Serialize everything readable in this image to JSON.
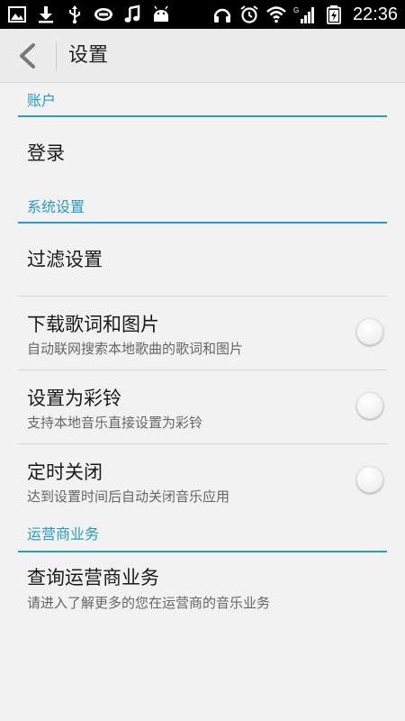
{
  "status_bar": {
    "time": "22:36",
    "left_icons": [
      "image-icon",
      "download-icon",
      "usb-icon",
      "dts-icon",
      "music-note-icon",
      "android-icon"
    ],
    "right_icons": [
      "headphones-icon",
      "alarm-icon",
      "wifi-icon",
      "signal-icon",
      "battery-icon"
    ],
    "signal_label": "G"
  },
  "header": {
    "title": "设置"
  },
  "sections": [
    {
      "label": "账户",
      "items": [
        {
          "title": "登录"
        }
      ]
    },
    {
      "label": "系统设置",
      "items": [
        {
          "title": "过滤设置"
        },
        {
          "title": "下载歌词和图片",
          "subtitle": "自动联网搜索本地歌曲的歌词和图片",
          "toggle": false
        },
        {
          "title": "设置为彩铃",
          "subtitle": "支持本地音乐直接设置为彩铃",
          "toggle": false
        },
        {
          "title": "定时关闭",
          "subtitle": "达到设置时间后自动关闭音乐应用",
          "toggle": false
        }
      ]
    },
    {
      "label": "运营商业务",
      "items": [
        {
          "title": "查询运营商业务",
          "subtitle": "请进入了解更多的您在运营商的音乐业务"
        }
      ]
    }
  ],
  "colors": {
    "accent": "#2a9bc2",
    "background": "#f2f2f2",
    "status_bar": "#000000"
  }
}
